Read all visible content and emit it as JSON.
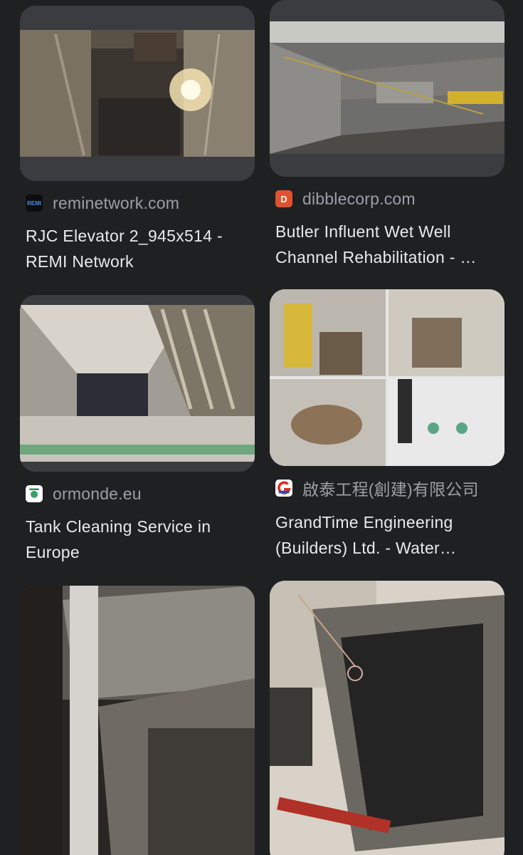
{
  "results": [
    {
      "source": "reminetwork.com",
      "title": "RJC Elevator 2_945x514 - REMI Network",
      "favicon": {
        "icon": "remi-favicon-icon",
        "text": "REMI",
        "bg": "#0d0d0d",
        "fg": "#4a8fe8"
      }
    },
    {
      "source": "dibblecorp.com",
      "title": "Butler Influent Wet Well Channel Rehabilitation - …",
      "favicon": {
        "icon": "dibble-favicon-icon",
        "text": "D",
        "bg": "#e0522f",
        "fg": "#ffffff"
      }
    },
    {
      "source": "ormonde.eu",
      "title": "Tank Cleaning Service in Europe",
      "favicon": {
        "icon": "ormonde-favicon-icon",
        "text": "",
        "bg": "#ffffff",
        "fg": "#2e8b57"
      }
    },
    {
      "source": "啟泰工程(創建)有限公司",
      "title": "GrandTime Engineering (Builders) Ltd. - Water…",
      "favicon": {
        "icon": "grandtime-favicon-icon",
        "text": "G",
        "bg": "#ffffff",
        "fg": "#d93025"
      }
    },
    {
      "source": "",
      "title": ""
    },
    {
      "source": "",
      "title": ""
    }
  ],
  "colors": {
    "background": "#1f2022",
    "source_text": "#9aa0a6",
    "title_text": "#e8eaed"
  }
}
